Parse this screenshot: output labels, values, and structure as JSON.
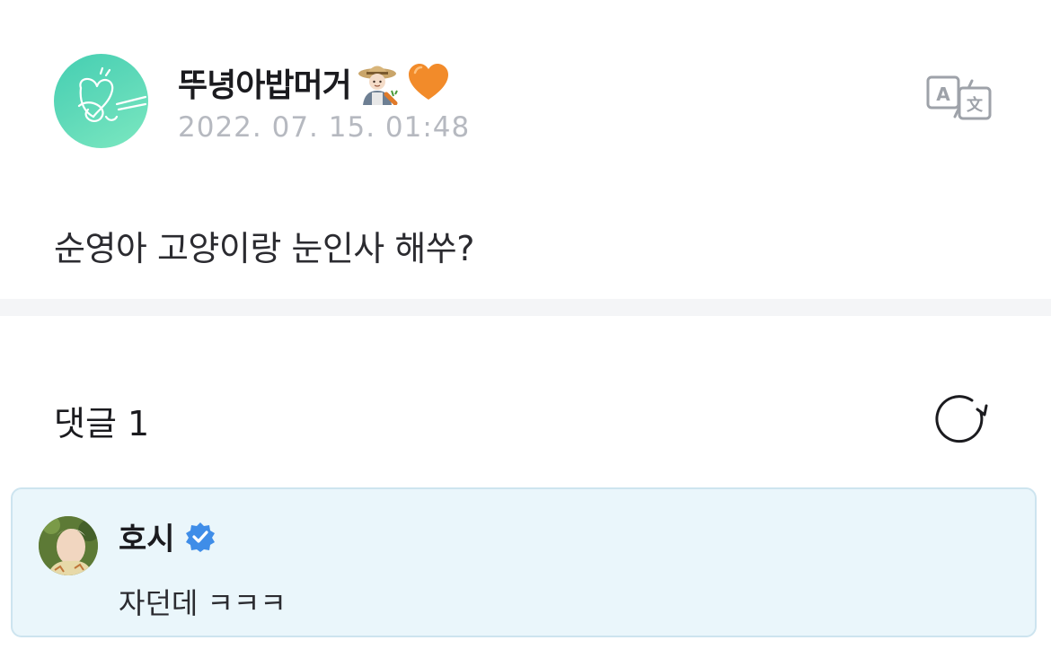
{
  "post": {
    "author_name": "뚜녕아밥머거",
    "author_emojis": [
      "farmer-emoji",
      "orange-heart-emoji"
    ],
    "date": "2022. 07. 15. 01:48",
    "body": "순영아 고양이랑 눈인사 해쑤?",
    "translate_icon": "translate-icon"
  },
  "comments": {
    "title": "댓글 1",
    "refresh_icon": "refresh-icon",
    "items": [
      {
        "author": "호시",
        "verified": true,
        "text": "자던데 ㅋㅋㅋ"
      }
    ]
  },
  "colors": {
    "avatar_gradient_start": "#45cfb2",
    "avatar_gradient_end": "#7ce8c0",
    "date_text": "#b6b9c0",
    "divider": "#f4f5f7",
    "comment_bg": "#eaf6fb",
    "comment_border": "#cde4ef",
    "verified_badge": "#3f8de8"
  }
}
